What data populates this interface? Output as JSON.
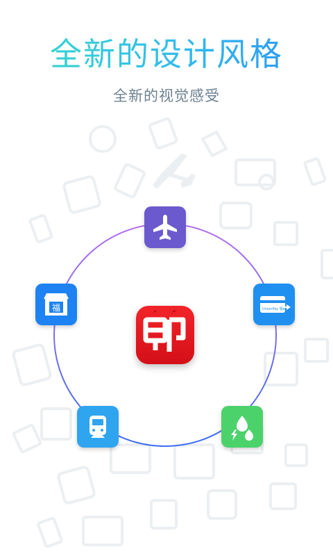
{
  "header": {
    "title": "全新的设计风格",
    "subtitle": "全新的视觉感受"
  },
  "app": {
    "icon_glyph": "即",
    "icon_name": "app-logo-icon"
  },
  "services": [
    {
      "name": "flight",
      "icon": "airplane-icon",
      "color": "#6a5acd"
    },
    {
      "name": "bank-card",
      "icon": "unionpay-card-icon",
      "color": "#1f8ff0",
      "card_text": "UnionPay 银联"
    },
    {
      "name": "utilities",
      "icon": "water-electric-gas-icon",
      "color": "#4cd26b"
    },
    {
      "name": "train",
      "icon": "train-icon",
      "color": "#2fa4ef"
    },
    {
      "name": "shop",
      "icon": "store-icon",
      "color": "#1e82f2",
      "shop_glyph": "福"
    }
  ],
  "colors": {
    "ring_start": "#b06cf0",
    "ring_end": "#3a6ff2",
    "background_icon": "#eef1f4"
  }
}
